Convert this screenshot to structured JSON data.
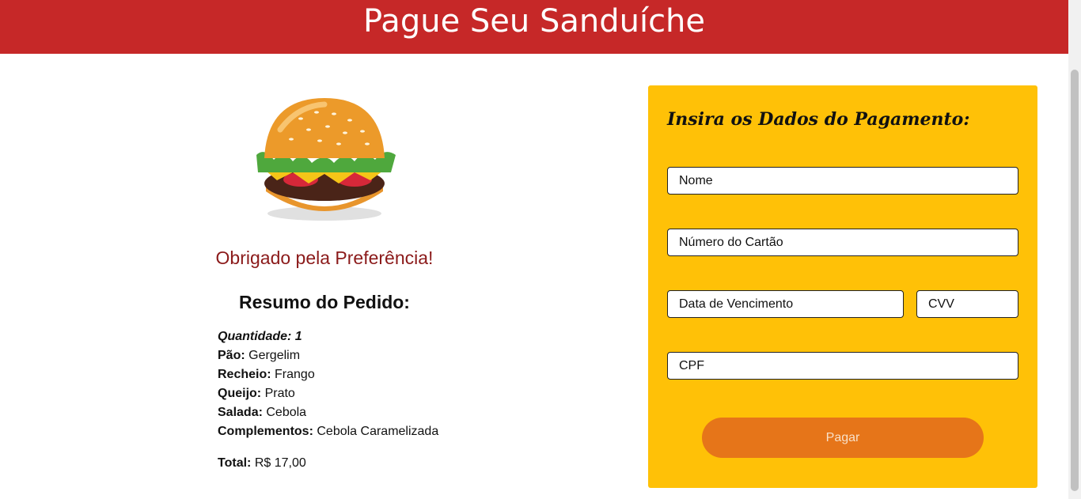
{
  "header": {
    "title": "Pague Seu Sanduíche"
  },
  "order": {
    "thanks": "Obrigado pela Preferência!",
    "summary_title": "Resumo do Pedido:",
    "quantity": "Quantidade: 1",
    "items": [
      {
        "label": "Pão:",
        "value": "Gergelim"
      },
      {
        "label": "Recheio:",
        "value": "Frango"
      },
      {
        "label": "Queijo:",
        "value": "Prato"
      },
      {
        "label": "Salada:",
        "value": "Cebola"
      },
      {
        "label": "Complementos:",
        "value": "Cebola Caramelizada"
      }
    ],
    "total_label": "Total:",
    "total_value": "R$ 17,00"
  },
  "payment": {
    "title": "Insira os Dados do Pagamento:",
    "name_placeholder": "Nome",
    "card_placeholder": "Número do Cartão",
    "expiry_placeholder": "Data de Vencimento",
    "cvv_placeholder": "CVV",
    "cpf_placeholder": "CPF",
    "pay_label": "Pagar"
  },
  "colors": {
    "header": "#c62828",
    "panel": "#ffc107",
    "button": "#e67519",
    "thanks_text": "#8b1a1a"
  }
}
